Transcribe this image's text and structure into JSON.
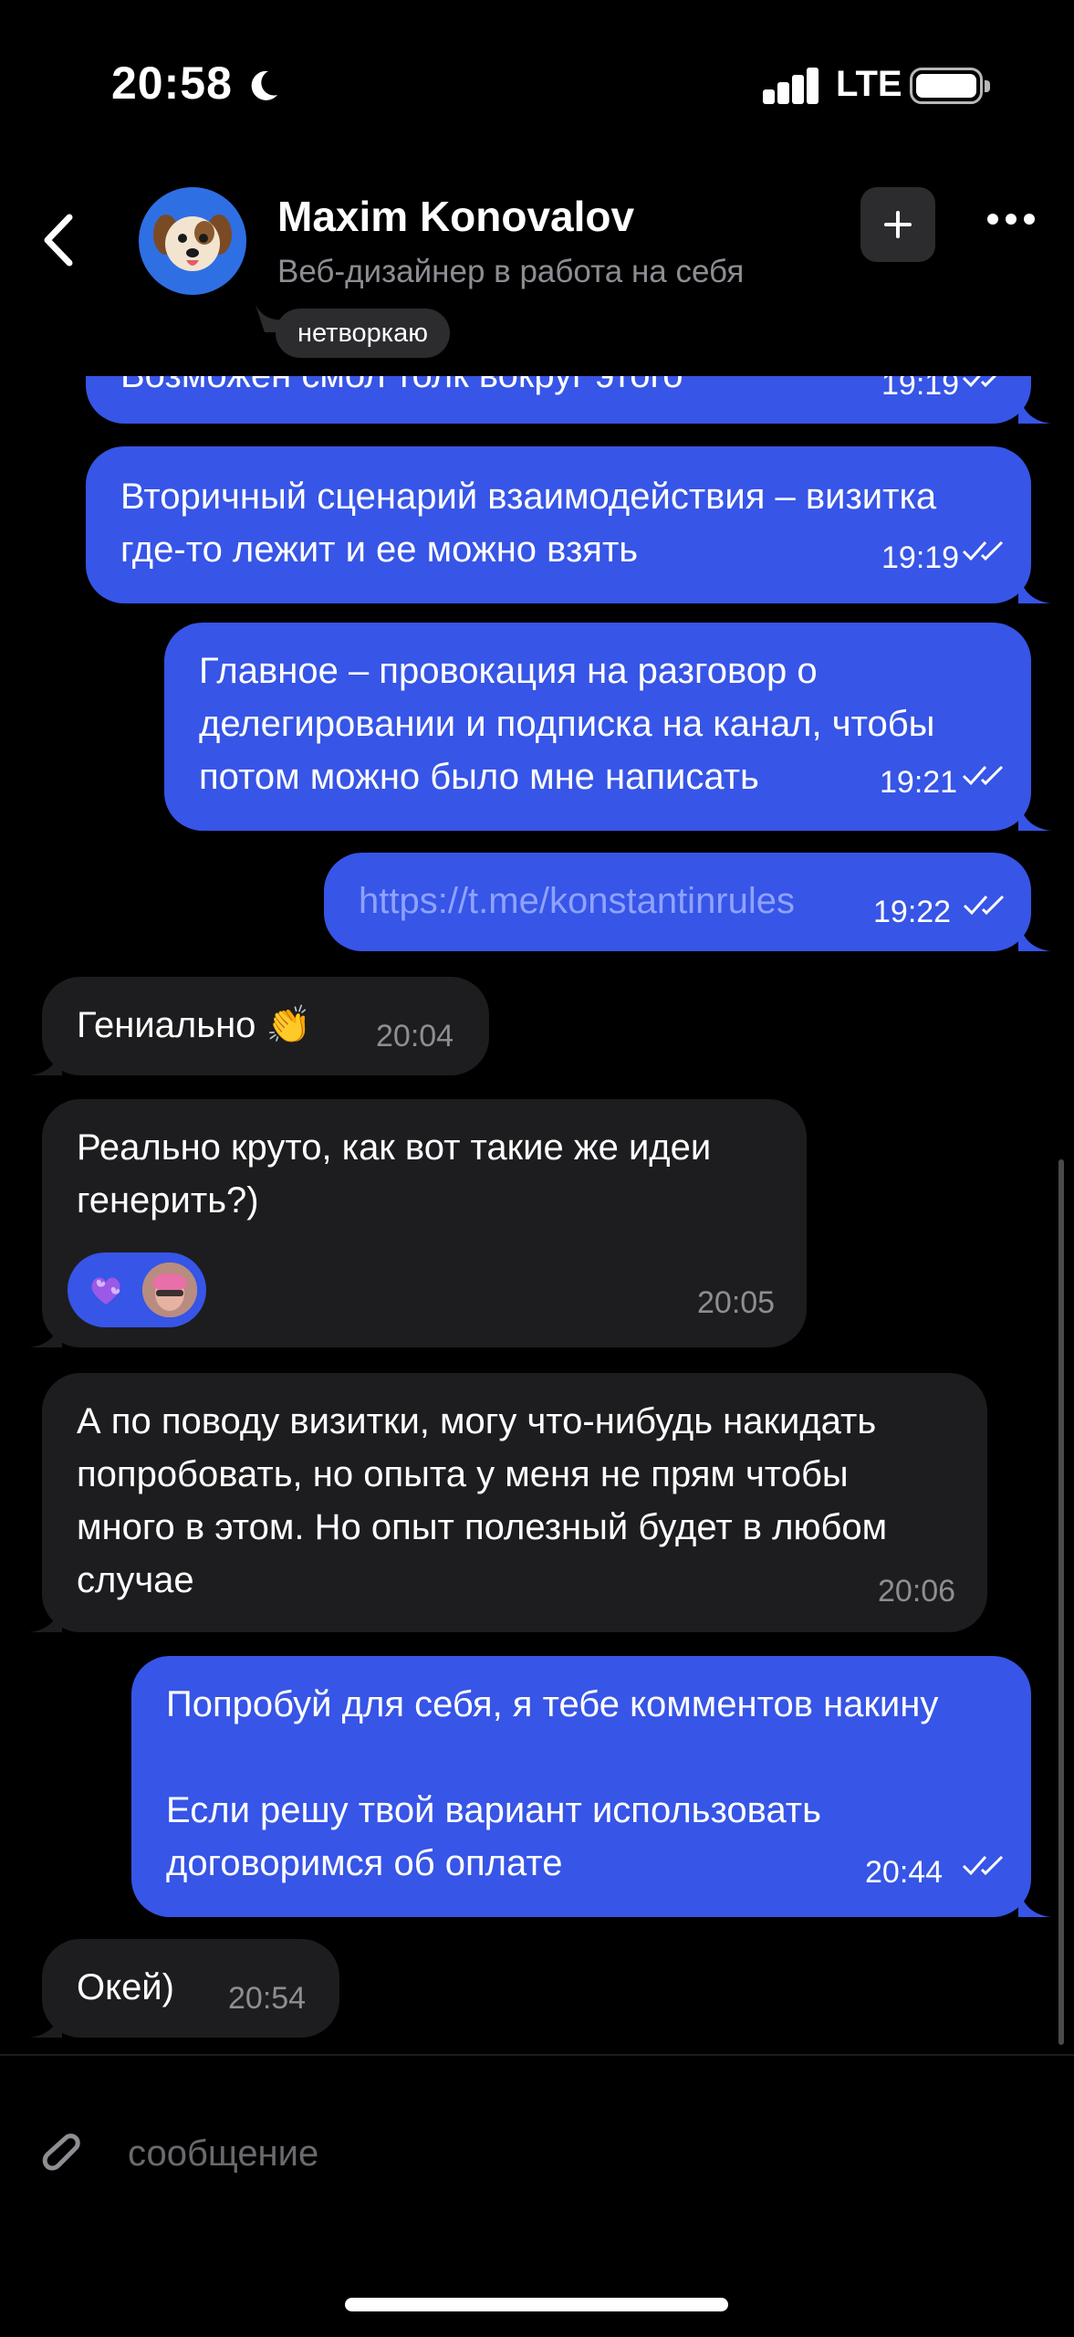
{
  "status_bar": {
    "time": "20:58",
    "network": "LTE",
    "icons": [
      "moon-icon",
      "signal-icon",
      "battery-icon"
    ]
  },
  "header": {
    "name": "Maxim Konovalov",
    "subtitle": "Веб-дизайнер в работа на себя",
    "tag": "нетворкаю",
    "icons": [
      "back-icon",
      "plus-icon",
      "more-icon"
    ]
  },
  "messages": [
    {
      "dir": "out",
      "text": "Возможен смол толк вокруг этого",
      "time": "19:19",
      "read": true
    },
    {
      "dir": "out",
      "text": "Вторичный сценарий взаимодействия – визитка\nгде-то лежит и ее можно взять",
      "time": "19:19",
      "read": true
    },
    {
      "dir": "out",
      "text": "Главное – провокация на разговор о\nделегировании и подписка на канал, чтобы\nпотом можно было мне написать",
      "time": "19:21",
      "read": true
    },
    {
      "dir": "out",
      "text": "https://t.me/konstantinrules",
      "time": "19:22",
      "read": true,
      "is_link": true
    },
    {
      "dir": "in",
      "text": "Гениально 👏",
      "time": "20:04"
    },
    {
      "dir": "in",
      "text": "Реально круто, как вот такие же идеи\nгенерить?)",
      "time": "20:05",
      "reaction": "purple-hearts"
    },
    {
      "dir": "in",
      "text": "А по поводу визитки, могу что-нибудь накидать\nпопробовать, но опыта у меня не прям чтобы\nмного в этом. Но опыт полезный будет в любом\nслучае",
      "time": "20:06"
    },
    {
      "dir": "out",
      "text": "Попробуй для себя, я тебе комментов накину\n\nЕсли решу твой вариант использовать\nдоговоримся об оплате",
      "time": "20:44",
      "read": true
    },
    {
      "dir": "in",
      "text": "Окей)",
      "time": "20:54"
    }
  ],
  "composer": {
    "placeholder": "сообщение",
    "icon": "paperclip-icon"
  },
  "colors": {
    "background": "#000000",
    "outgoing_bubble": "#3755e6",
    "incoming_bubble": "#1d1d1f",
    "secondary_text": "#8d8d93"
  }
}
